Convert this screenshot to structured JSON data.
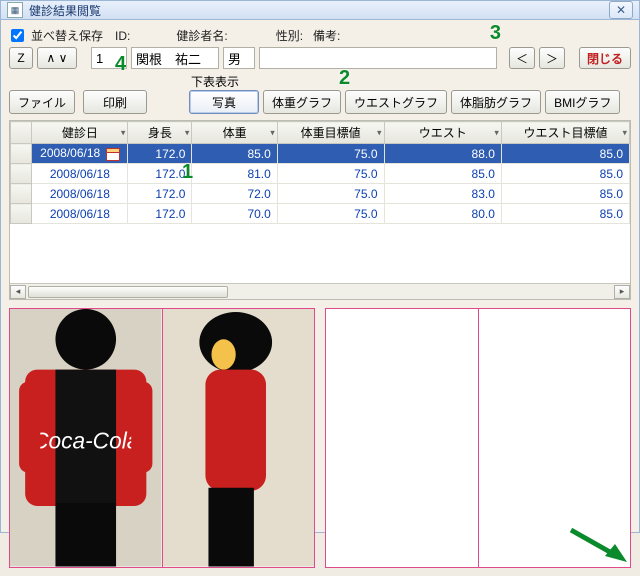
{
  "window": {
    "title": "健診結果閲覧"
  },
  "row1": {
    "sort_save_label": "並べ替え保存",
    "z_btn": "Z",
    "caret_btn": "∧ ∨",
    "id_label": "ID:",
    "id_value": "1",
    "name_label": "健診者名:",
    "name_value": "関根　祐二",
    "sex_label": "性別:",
    "sex_value": "男",
    "remark_label": "備考:",
    "remark_value": "",
    "prev": "＜",
    "next": "＞",
    "close": "閉じる"
  },
  "row2": {
    "file_btn": "ファイル",
    "print_btn": "印刷",
    "subtable_label": "下表表示",
    "tab_photo": "写真",
    "tab_weight": "体重グラフ",
    "tab_waist": "ウエストグラフ",
    "tab_bodyfat": "体脂肪グラフ",
    "tab_bmi": "BMIグラフ"
  },
  "columns": [
    "健診日",
    "身長",
    "体重",
    "体重目標値",
    "ウエスト",
    "ウエスト目標値"
  ],
  "rows": [
    {
      "date": "2008/06/18",
      "height": "172.0",
      "weight": "85.0",
      "weight_goal": "75.0",
      "waist": "88.0",
      "waist_goal": "85.0",
      "selected": true,
      "has_cal": true
    },
    {
      "date": "2008/06/18",
      "height": "172.0",
      "weight": "81.0",
      "weight_goal": "75.0",
      "waist": "85.0",
      "waist_goal": "85.0"
    },
    {
      "date": "2008/06/18",
      "height": "172.0",
      "weight": "72.0",
      "weight_goal": "75.0",
      "waist": "83.0",
      "waist_goal": "85.0"
    },
    {
      "date": "2008/06/18",
      "height": "172.0",
      "weight": "70.0",
      "weight_goal": "75.0",
      "waist": "80.0",
      "waist_goal": "85.0"
    }
  ],
  "annotations": {
    "a1": "1",
    "a2": "2",
    "a3": "3",
    "a4": "4"
  }
}
